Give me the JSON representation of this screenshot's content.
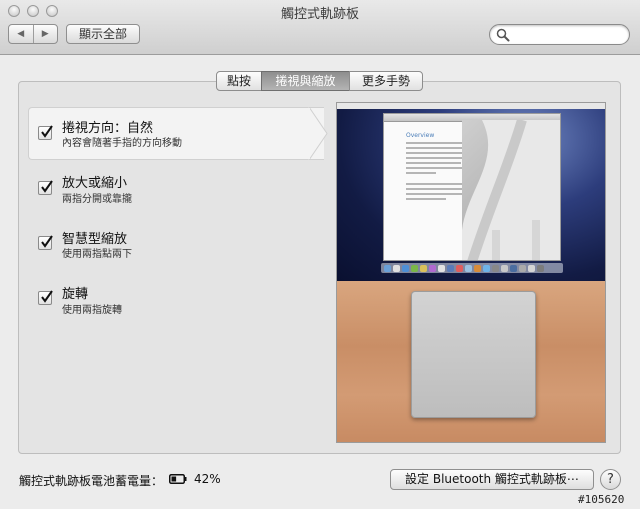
{
  "window": {
    "title": "觸控式軌跡板"
  },
  "toolbar": {
    "back_icon": "chevron-left-icon",
    "forward_icon": "chevron-right-icon",
    "show_all_label": "顯示全部",
    "search_placeholder": "",
    "search_icon": "magnifier-icon"
  },
  "tabs": [
    {
      "label": "點按",
      "active": false
    },
    {
      "label": "捲視與縮放",
      "active": true
    },
    {
      "label": "更多手勢",
      "active": false
    }
  ],
  "gestures": [
    {
      "title": "捲視方向：自然",
      "description": "內容會隨著手指的方向移動",
      "checked": true,
      "selected": true
    },
    {
      "title": "放大或縮小",
      "description": "兩指分開或靠攏",
      "checked": true,
      "selected": false
    },
    {
      "title": "智慧型縮放",
      "description": "使用兩指點兩下",
      "checked": true,
      "selected": false
    },
    {
      "title": "旋轉",
      "description": "使用兩指旋轉",
      "checked": true,
      "selected": false
    }
  ],
  "preview": {
    "doc_heading": "Overview"
  },
  "footer": {
    "battery_label": "觸控式軌跡板電池蓄電量：",
    "battery_icon": "battery-icon",
    "battery_level": 0.42,
    "battery_percent": "42%",
    "bluetooth_button": "設定 Bluetooth 觸控式軌跡板⋯",
    "help_label": "?"
  },
  "watermark": "#105620",
  "colors": {
    "accent_link": "#4a7db8",
    "active_tab": "#9a9a9a"
  }
}
